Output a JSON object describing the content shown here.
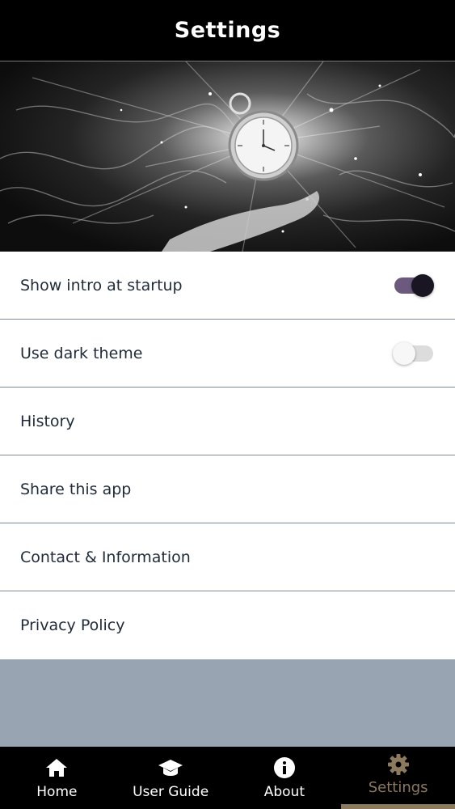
{
  "header": {
    "title": "Settings"
  },
  "settings": {
    "items": [
      {
        "label": "Show intro at startup",
        "toggle": "on"
      },
      {
        "label": "Use dark theme",
        "toggle": "off"
      },
      {
        "label": "History"
      },
      {
        "label": "Share this app"
      },
      {
        "label": "Contact & Information"
      },
      {
        "label": "Privacy Policy"
      }
    ]
  },
  "tabbar": {
    "tabs": [
      {
        "label": "Home",
        "icon": "home-icon",
        "active": false
      },
      {
        "label": "User Guide",
        "icon": "graduation-cap-icon",
        "active": false
      },
      {
        "label": "About",
        "icon": "info-icon",
        "active": false
      },
      {
        "label": "Settings",
        "icon": "gear-icon",
        "active": true
      }
    ]
  },
  "colors": {
    "header_bg": "#000000",
    "toggle_on_track": "#6b5a7e",
    "toggle_on_knob": "#1a1522",
    "active_tab": "#8b7a5e",
    "page_bg": "#98a4b2"
  }
}
